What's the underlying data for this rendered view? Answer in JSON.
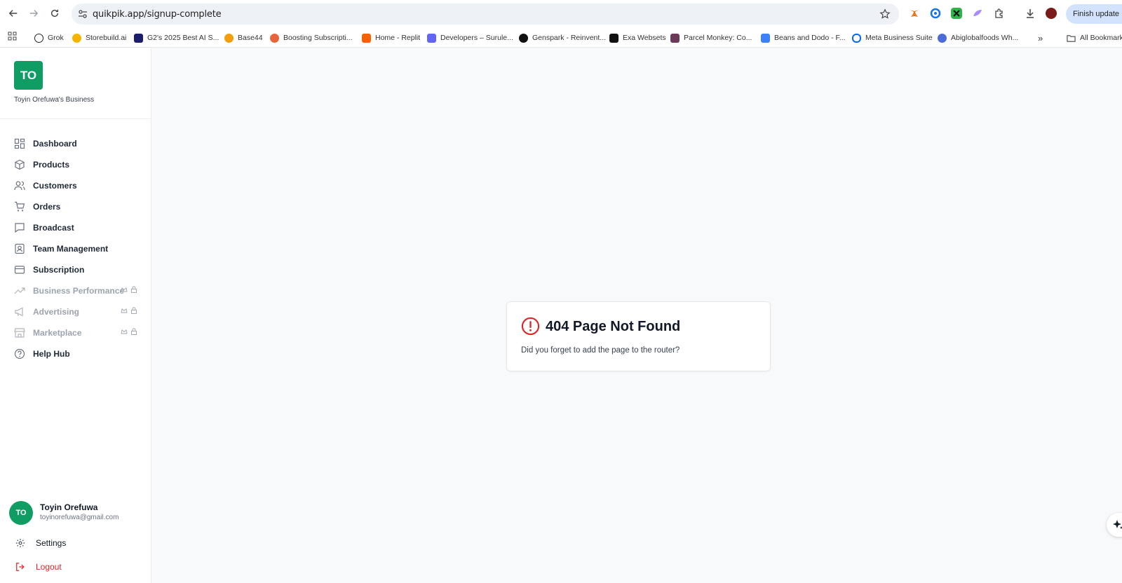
{
  "browser": {
    "url": "quikpik.app/signup-complete",
    "finish_update_label": "Finish update",
    "bookmarks": [
      {
        "label": "Grok",
        "icon": "grok-icon"
      },
      {
        "label": "Storebuild.ai",
        "icon": "storebuild-icon"
      },
      {
        "label": "G2's 2025 Best AI S...",
        "icon": "g2-icon"
      },
      {
        "label": "Base44",
        "icon": "base44-icon"
      },
      {
        "label": "Boosting Subscripti...",
        "icon": "boosting-icon"
      },
      {
        "label": "Home - Replit",
        "icon": "replit-icon"
      },
      {
        "label": "Developers – Surule...",
        "icon": "surule-icon"
      },
      {
        "label": "Genspark - Reinvent...",
        "icon": "genspark-icon"
      },
      {
        "label": "Exa Websets",
        "icon": "exa-icon"
      },
      {
        "label": "Parcel Monkey: Co...",
        "icon": "parcelmonkey-icon"
      },
      {
        "label": "Beans and Dodo - F...",
        "icon": "beansdodo-icon"
      },
      {
        "label": "Meta Business Suite",
        "icon": "meta-icon"
      },
      {
        "label": "Abiglobalfoods Wh...",
        "icon": "abiglobal-icon"
      }
    ],
    "all_bookmarks_label": "All Bookmarks"
  },
  "sidebar": {
    "logo_initials": "TO",
    "business_name": "Toyin Orefuwa's Business",
    "items": [
      {
        "label": "Dashboard",
        "icon": "dashboard-icon",
        "locked": false
      },
      {
        "label": "Products",
        "icon": "box-icon",
        "locked": false
      },
      {
        "label": "Customers",
        "icon": "users-icon",
        "locked": false
      },
      {
        "label": "Orders",
        "icon": "cart-icon",
        "locked": false
      },
      {
        "label": "Broadcast",
        "icon": "message-icon",
        "locked": false
      },
      {
        "label": "Team Management",
        "icon": "contact-icon",
        "locked": false
      },
      {
        "label": "Subscription",
        "icon": "card-icon",
        "locked": false
      },
      {
        "label": "Business Performance",
        "icon": "trending-icon",
        "locked": true
      },
      {
        "label": "Advertising",
        "icon": "megaphone-icon",
        "locked": true
      },
      {
        "label": "Marketplace",
        "icon": "store-icon",
        "locked": true
      },
      {
        "label": "Help Hub",
        "icon": "help-icon",
        "locked": false
      }
    ],
    "user": {
      "initials": "TO",
      "name": "Toyin Orefuwa",
      "email": "toyinorefuwa@gmail.com"
    },
    "settings_label": "Settings",
    "logout_label": "Logout"
  },
  "main": {
    "error_title": "404 Page Not Found",
    "error_message": "Did you forget to add the page to the router?"
  },
  "colors": {
    "brand_green": "#0f9d64",
    "error_red": "#dc2626",
    "logout_red": "#dc2626"
  }
}
